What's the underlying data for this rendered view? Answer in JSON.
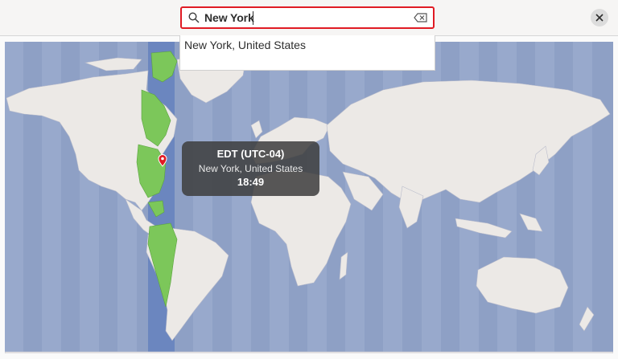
{
  "search": {
    "query": "New York",
    "icon": "search-icon",
    "clear_icon": "backspace-icon",
    "border_color": "#e01b24"
  },
  "results": [
    {
      "label": "New York, United States"
    }
  ],
  "header": {
    "close_icon": "close-icon"
  },
  "map": {
    "ocean_color": "#8ea0c5",
    "land_color": "#ece9e6",
    "selected_zone_color": "#7cc75a",
    "selected_band_color": "#6b86bf"
  },
  "tooltip": {
    "timezone": "EDT (UTC-04)",
    "city": "New York, United States",
    "time": "18:49"
  },
  "marker": {
    "icon": "location-pin-icon",
    "color": "#e01b24"
  }
}
